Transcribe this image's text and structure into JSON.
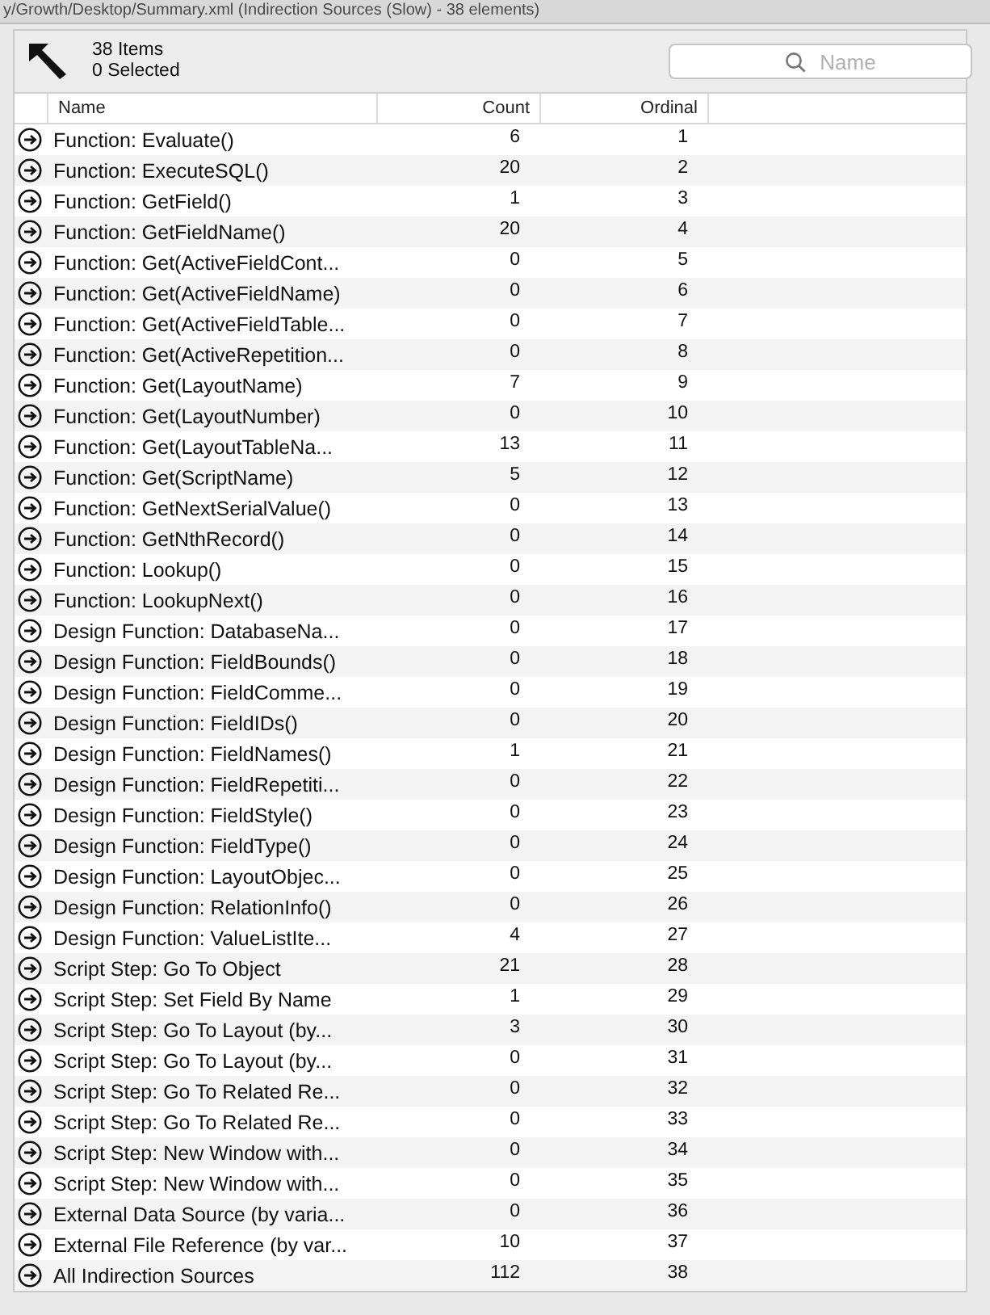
{
  "window": {
    "title": "y/Growth/Desktop/Summary.xml  (Indirection Sources (Slow) - 38 elements)"
  },
  "toolbar": {
    "item_count": "38 Items",
    "selected_count": "0 Selected",
    "search": {
      "placeholder": "Name"
    }
  },
  "table": {
    "columns": [
      "Name",
      "Count",
      "Ordinal"
    ],
    "rows": [
      {
        "name": "Function: Evaluate()",
        "count": "6",
        "ordinal": "1"
      },
      {
        "name": "Function: ExecuteSQL()",
        "count": "20",
        "ordinal": "2"
      },
      {
        "name": "Function: GetField()",
        "count": "1",
        "ordinal": "3"
      },
      {
        "name": "Function: GetFieldName()",
        "count": "20",
        "ordinal": "4"
      },
      {
        "name": "Function: Get(ActiveFieldCont...",
        "count": "0",
        "ordinal": "5"
      },
      {
        "name": "Function: Get(ActiveFieldName)",
        "count": "0",
        "ordinal": "6"
      },
      {
        "name": "Function: Get(ActiveFieldTable...",
        "count": "0",
        "ordinal": "7"
      },
      {
        "name": "Function: Get(ActiveRepetition...",
        "count": "0",
        "ordinal": "8"
      },
      {
        "name": "Function: Get(LayoutName)",
        "count": "7",
        "ordinal": "9"
      },
      {
        "name": "Function: Get(LayoutNumber)",
        "count": "0",
        "ordinal": "10"
      },
      {
        "name": "Function: Get(LayoutTableNa...",
        "count": "13",
        "ordinal": "11"
      },
      {
        "name": "Function: Get(ScriptName)",
        "count": "5",
        "ordinal": "12"
      },
      {
        "name": "Function: GetNextSerialValue()",
        "count": "0",
        "ordinal": "13"
      },
      {
        "name": "Function: GetNthRecord()",
        "count": "0",
        "ordinal": "14"
      },
      {
        "name": "Function: Lookup()",
        "count": "0",
        "ordinal": "15"
      },
      {
        "name": "Function: LookupNext()",
        "count": "0",
        "ordinal": "16"
      },
      {
        "name": "Design Function: DatabaseNa...",
        "count": "0",
        "ordinal": "17"
      },
      {
        "name": "Design Function: FieldBounds()",
        "count": "0",
        "ordinal": "18"
      },
      {
        "name": "Design Function: FieldComme...",
        "count": "0",
        "ordinal": "19"
      },
      {
        "name": "Design Function: FieldIDs()",
        "count": "0",
        "ordinal": "20"
      },
      {
        "name": "Design Function: FieldNames()",
        "count": "1",
        "ordinal": "21"
      },
      {
        "name": "Design Function: FieldRepetiti...",
        "count": "0",
        "ordinal": "22"
      },
      {
        "name": "Design Function: FieldStyle()",
        "count": "0",
        "ordinal": "23"
      },
      {
        "name": "Design Function: FieldType()",
        "count": "0",
        "ordinal": "24"
      },
      {
        "name": "Design Function: LayoutObjec...",
        "count": "0",
        "ordinal": "25"
      },
      {
        "name": "Design Function: RelationInfo()",
        "count": "0",
        "ordinal": "26"
      },
      {
        "name": "Design Function: ValueListIte...",
        "count": "4",
        "ordinal": "27"
      },
      {
        "name": "Script Step: Go To Object",
        "count": "21",
        "ordinal": "28"
      },
      {
        "name": "Script Step: Set Field By Name",
        "count": "1",
        "ordinal": "29"
      },
      {
        "name": "Script Step: Go To Layout (by...",
        "count": "3",
        "ordinal": "30"
      },
      {
        "name": "Script Step: Go To Layout (by...",
        "count": "0",
        "ordinal": "31"
      },
      {
        "name": "Script Step: Go To Related Re...",
        "count": "0",
        "ordinal": "32"
      },
      {
        "name": "Script Step: Go To Related Re...",
        "count": "0",
        "ordinal": "33"
      },
      {
        "name": "Script Step: New Window with...",
        "count": "0",
        "ordinal": "34"
      },
      {
        "name": "Script Step: New Window with...",
        "count": "0",
        "ordinal": "35"
      },
      {
        "name": "External Data Source (by varia...",
        "count": "0",
        "ordinal": "36"
      },
      {
        "name": "External File Reference (by var...",
        "count": "10",
        "ordinal": "37"
      },
      {
        "name": "All Indirection Sources",
        "count": "112",
        "ordinal": "38"
      }
    ]
  }
}
